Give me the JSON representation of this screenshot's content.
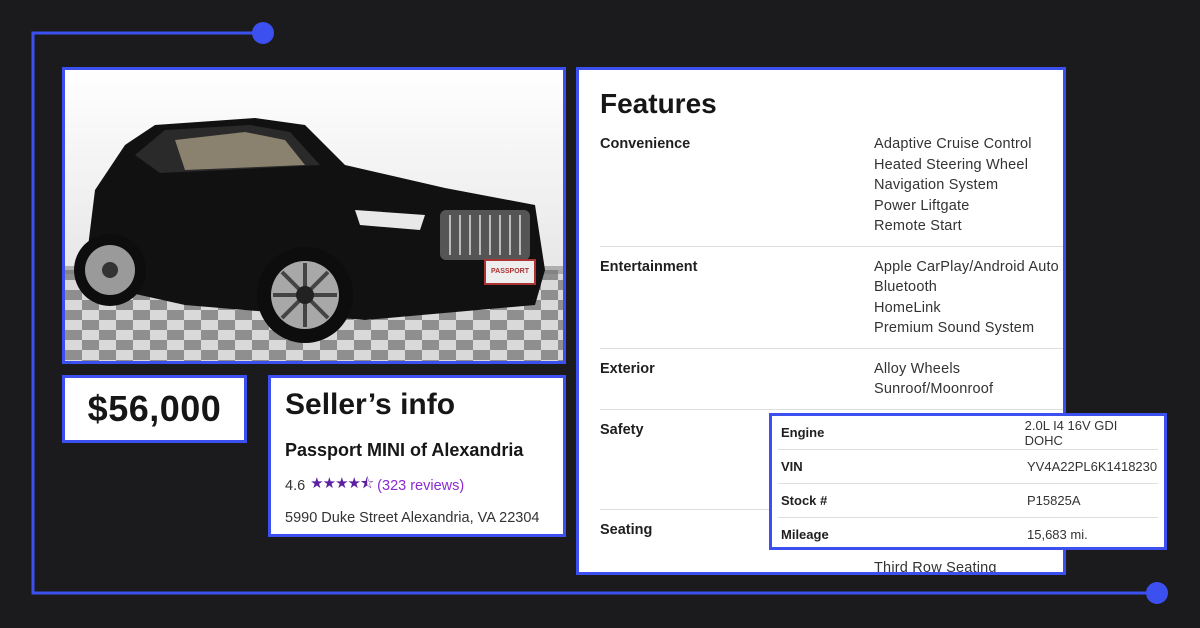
{
  "colors": {
    "accent": "#3c50ef",
    "background": "#1b1b1d",
    "rating_stars": "#5b1fa0",
    "reviews_link": "#8a2bd1"
  },
  "listing": {
    "price": "$56,000",
    "plate_text": "PASSPORT"
  },
  "seller": {
    "title": "Seller’s info",
    "dealer_name": "Passport MINI of Alexandria",
    "rating": "4.6",
    "stars_glyph": "★★★★⯪",
    "reviews": "(323 reviews)",
    "address": "5990 Duke Street Alexandria, VA 22304"
  },
  "features": {
    "title": "Features",
    "categories": [
      {
        "name": "Convenience",
        "items": [
          "Adaptive Cruise Control",
          "Heated Steering Wheel",
          "Navigation System",
          "Power Liftgate",
          "Remote Start"
        ]
      },
      {
        "name": "Entertainment",
        "items": [
          "Apple CarPlay/Android Auto",
          "Bluetooth",
          "HomeLink",
          "Premium Sound System"
        ]
      },
      {
        "name": "Exterior",
        "items": [
          "Alloy Wheels",
          "Sunroof/Moonroof"
        ]
      },
      {
        "name": "Safety",
        "items": []
      },
      {
        "name": "Seating",
        "items": [
          "Third Row Seating"
        ]
      }
    ]
  },
  "specs": [
    {
      "label": "Engine",
      "value": "2.0L I4 16V GDI DOHC"
    },
    {
      "label": "VIN",
      "value": "YV4A22PL6K1418230"
    },
    {
      "label": "Stock #",
      "value": "P15825A"
    },
    {
      "label": "Mileage",
      "value": "15,683 mi."
    }
  ]
}
